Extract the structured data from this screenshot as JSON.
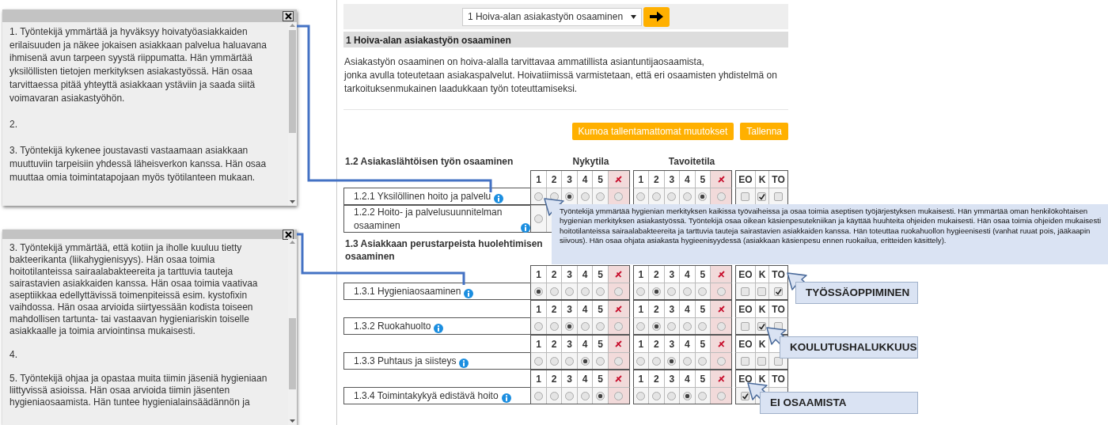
{
  "panels": [
    {
      "paragraphs": [
        "1. Työntekijä ymmärtää ja hyväksyy hoivatyöasiakkaiden erilaisuuden ja näkee jokaisen asiakkaan palvelua haluavana ihmisenä avun tarpeen syystä riippumatta. Hän ymmärtää yksilöllisten tietojen merkityksen asiakastyössä. Hän osaa tarvittaessa pitää yhteyttä asiakkaan ystäviin ja saada siitä voimavaran asiakastyöhön.",
        "2.",
        "3. Työntekijä kykenee joustavasti vastaamaan asiakkaan muuttuviin tarpeisiin yhdessä läheisverkon kanssa. Hän osaa muuttaa omia toimintatapojaan myös työtilanteen mukaan."
      ]
    },
    {
      "paragraphs": [
        "3. Työntekijä ymmärtää, että kotiin ja iholle kuuluu tietty bakteerikanta (liikahygienisyys). Hän osaa toimia hoitotilanteissa sairaalabakteereita ja tarttuvia tauteja sairastavien asiakkaiden kanssa. Hän osaa toimia vaativaa aseptiikkaa edellyttävissä toimenpiteissä esim. kystofixin vaihdossa. Hän osaa arvioida siirtyessään kodista toiseen mahdollisen tartunta- tai vastaavan hygieniariskin toiselle asiakkaalle ja toimia arviointinsa mukaisesti.",
        "4.",
        "5. Työntekijä ohjaa ja opastaa muita tiimin jäseniä hygieniaan liittyvissä asioissa. Hän osaa arvioida tiimin jäsenten hygieniaosaamista. Hän tuntee hygienialainsäädännön ja"
      ]
    }
  ],
  "selector": {
    "value": "1 Hoiva-alan asiakastyön osaaminen"
  },
  "section_title": "1 Hoiva-alan asiakastyön osaaminen",
  "intro": [
    "Asiakastyön osaaminen on hoiva-alalla tarvittavaa ammatillista asiantuntijaosaamista,",
    "jonka avulla toteutetaan asiakaspalvelut. Hoivatiimissä varmistetaan, että eri osaamisten yhdistelmä on tarkoituksenmukainen laadukkaan työn toteuttamiseksi."
  ],
  "buttons": [
    {
      "label": "Kumoa tallentamattomat muutokset"
    },
    {
      "label": "Tallenna"
    }
  ],
  "groups": [
    {
      "title": "1.2 Asiakaslähtöisen työn osaaminen",
      "column_titles": [
        "Nykytila",
        "Tavoitetila"
      ],
      "rows": [
        {
          "kind": "header",
          "current": [
            "1",
            "2",
            "3",
            "4",
            "5"
          ],
          "target": [
            "1",
            "2",
            "3",
            "4",
            "5"
          ],
          "flags": [
            "EO",
            "K",
            "TO"
          ]
        },
        {
          "kind": "item",
          "label": "1.2.1 Yksilöllinen hoito ja palvelu",
          "current": [
            {
              "selected": false
            },
            {
              "selected": false
            },
            {
              "selected": true
            },
            {
              "selected": false
            },
            {
              "selected": false
            },
            {
              "selected": false
            }
          ],
          "target": [
            {
              "selected": false
            },
            {
              "selected": false
            },
            {
              "selected": false
            },
            {
              "selected": false
            },
            {
              "selected": true
            },
            {
              "selected": false
            }
          ],
          "flags": [
            {
              "checked": false
            },
            {
              "checked": true
            },
            {
              "checked": false
            }
          ]
        },
        {
          "kind": "item",
          "label": "1.2.2 Hoito- ja palvelusuunnitelman osaaminen",
          "current": [
            {
              "selected": false
            }
          ],
          "target": [],
          "flags": []
        }
      ]
    },
    {
      "title": "1.3 Asiakkaan perustarpeista huolehtimisen osaaminen",
      "rows": [
        {
          "kind": "header",
          "current": [
            "1",
            "2",
            "3",
            "4",
            "5"
          ],
          "target": [
            "1",
            "2",
            "3",
            "4",
            "5"
          ],
          "flags": [
            "EO",
            "K",
            "TO"
          ]
        },
        {
          "kind": "item",
          "label": "1.3.1 Hygieniaosaaminen",
          "current": [
            {
              "selected": true
            },
            {
              "selected": false
            },
            {
              "selected": false
            },
            {
              "selected": false
            },
            {
              "selected": false
            },
            {
              "selected": false
            }
          ],
          "target": [
            {
              "selected": false
            },
            {
              "selected": true
            },
            {
              "selected": false
            },
            {
              "selected": false
            },
            {
              "selected": false
            },
            {
              "selected": false
            }
          ],
          "flags": [
            {
              "checked": false
            },
            {
              "checked": false
            },
            {
              "checked": true
            }
          ]
        },
        {
          "kind": "header",
          "current": [
            "1",
            "2",
            "3",
            "4",
            "5"
          ],
          "target": [
            "1",
            "2",
            "3",
            "4",
            "5"
          ],
          "flags": [
            "EO",
            "K",
            "TO"
          ]
        },
        {
          "kind": "item",
          "label": "1.3.2 Ruokahuolto",
          "current": [
            {
              "selected": false
            },
            {
              "selected": false
            },
            {
              "selected": true
            },
            {
              "selected": false
            },
            {
              "selected": false
            },
            {
              "selected": false
            }
          ],
          "target": [
            {
              "selected": false
            },
            {
              "selected": true
            },
            {
              "selected": false
            },
            {
              "selected": false
            },
            {
              "selected": false
            },
            {
              "selected": false
            }
          ],
          "flags": [
            {
              "checked": false
            },
            {
              "checked": true
            },
            {
              "checked": false
            }
          ]
        },
        {
          "kind": "header",
          "current": [
            "1",
            "2",
            "3",
            "4",
            "5"
          ],
          "target": [
            "1",
            "2",
            "3",
            "4",
            "5"
          ],
          "flags": [
            "EO",
            "K"
          ]
        },
        {
          "kind": "item",
          "label": "1.3.3 Puhtaus ja siisteys",
          "current": [
            {
              "selected": false
            },
            {
              "selected": false
            },
            {
              "selected": false
            },
            {
              "selected": true
            },
            {
              "selected": false
            },
            {
              "selected": false
            }
          ],
          "target": [
            {
              "selected": false
            },
            {
              "selected": false
            },
            {
              "selected": true
            },
            {
              "selected": false
            },
            {
              "selected": false
            },
            {
              "selected": false
            }
          ],
          "flags": [
            {
              "checked": false
            },
            {
              "checked": false
            },
            {
              "checked": false
            }
          ]
        },
        {
          "kind": "header",
          "current": [
            "1",
            "2",
            "3",
            "4",
            "5"
          ],
          "target": [
            "1",
            "2",
            "3",
            "4",
            "5"
          ],
          "flags": [
            "EO",
            "K",
            "TO"
          ]
        },
        {
          "kind": "item",
          "label": "1.3.4 Toimintakykyä edistävä hoito",
          "current": [
            {
              "selected": false
            },
            {
              "selected": false
            },
            {
              "selected": false
            },
            {
              "selected": false
            },
            {
              "selected": true
            },
            {
              "selected": false
            }
          ],
          "target": [
            {
              "selected": false
            },
            {
              "selected": false
            },
            {
              "selected": false
            },
            {
              "selected": true
            },
            {
              "selected": false
            },
            {
              "selected": false
            }
          ],
          "flags": [
            {
              "checked": true
            }
          ]
        }
      ]
    }
  ],
  "tooltip": {
    "text": "Työntekijä ymmärtää hygienian merkityksen kaikissa työvaiheissa ja osaa toimia aseptisen työjärjestyksen mukaisesti. Hän ymmärtää oman henkilökohtaisen hygienian merkityksen asiakastyössä. Työntekijä osaa oikean käsienpesutekniikan ja käyttää huuhteita ohjeiden mukaisesti. Hän osaa toimia ohjeiden mukaisesti hoitotilanteissa sairaalabakteereita ja tarttuvia tauteja sairastavien asiakkaiden kanssa. Hän toteuttaa ruokahuollon hygieenisesti (vanhat ruuat pois, jääkaapin siivous). Hän osaa ohjata asiakasta hygieenisyydessä (asiakkaan käsienpesu ennen ruokailua, eritteiden käsittely)."
  },
  "callouts": [
    {
      "label": "TYÖSSÄOPPIMINEN"
    },
    {
      "label": "KOULUTUSHALUKKUUS"
    },
    {
      "label": "EI OSAAMISTA"
    }
  ]
}
